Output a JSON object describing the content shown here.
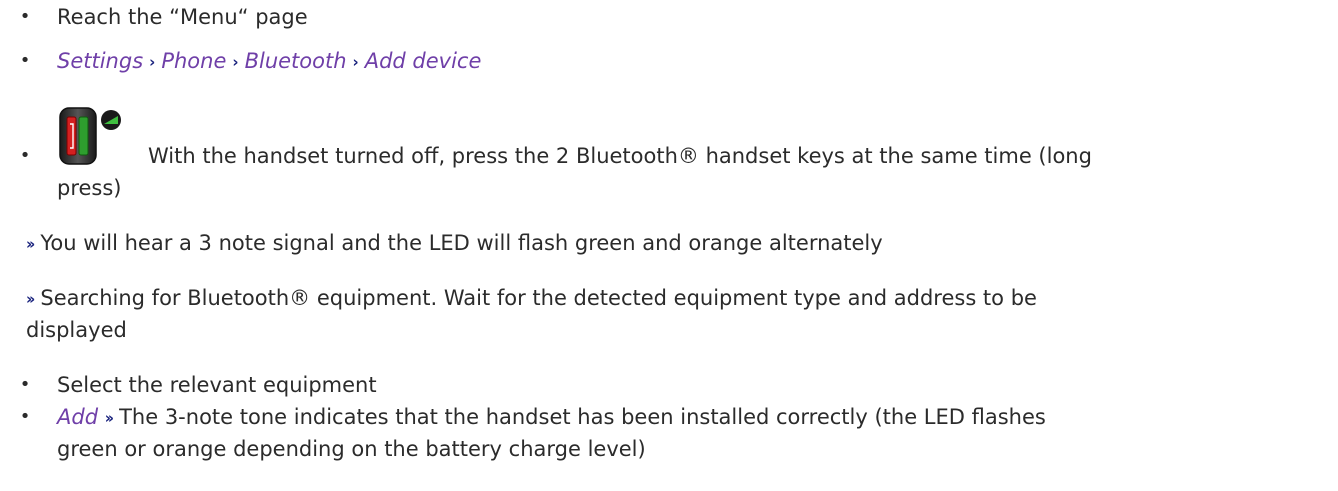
{
  "steps": [
    {
      "text": "Reach the “Menu“ page"
    },
    {
      "path": [
        "Settings",
        "Phone",
        "Bluetooth",
        "Add device"
      ]
    },
    {
      "text_line1": "With the handset turned off, press the 2 Bluetooth® handset keys at the same time (long",
      "text_line2": "press)"
    },
    {
      "text": "Select the relevant equipment"
    },
    {
      "action": "Add",
      "text_line1": "The 3-note tone indicates that the handset has been installed correctly (the LED flashes",
      "text_line2": "green or orange depending on the battery charge level)"
    }
  ],
  "notes": [
    {
      "text": "You will hear a 3 note signal and the LED will flash green and orange alternately"
    },
    {
      "text_line1": "Searching for Bluetooth® equipment. Wait for the detected equipment type and address to be",
      "text_line2": "displayed"
    }
  ],
  "symbols": {
    "bullet": "•",
    "path_separator": "›",
    "result_arrow": "››"
  },
  "icons": {
    "handset_keys": "bluetooth-handset-keys-icon"
  },
  "colors": {
    "text": "#2b2b2b",
    "menu_path": "#6f3fa8",
    "arrow": "#1a237e",
    "icon_green": "#2e9e2e",
    "icon_red": "#d42020"
  }
}
